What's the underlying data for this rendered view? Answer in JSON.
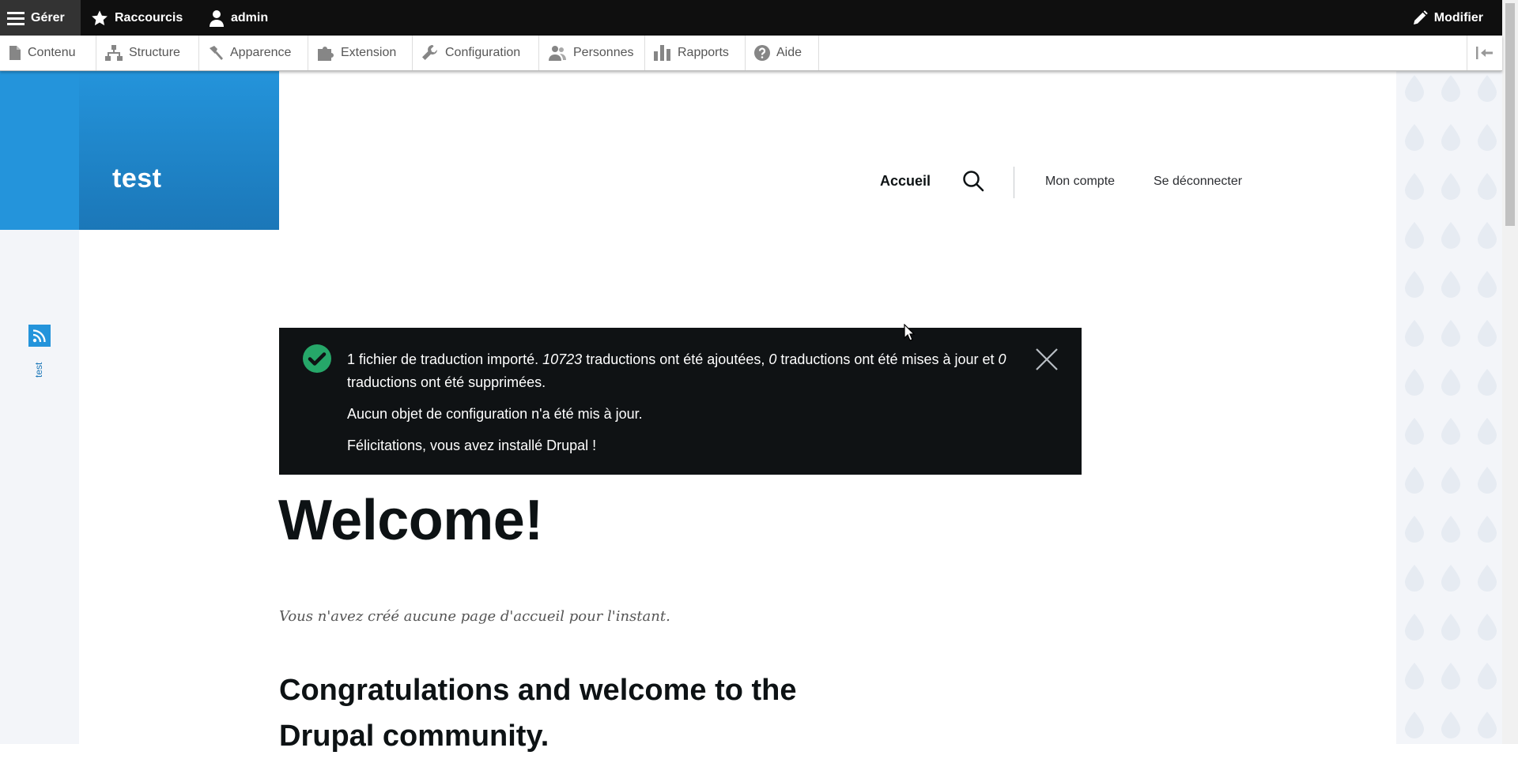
{
  "toolbar": {
    "manage": "Gérer",
    "shortcuts": "Raccourcis",
    "user": "admin",
    "edit": "Modifier"
  },
  "tray": {
    "items": [
      {
        "label": "Contenu",
        "icon": "file-icon"
      },
      {
        "label": "Structure",
        "icon": "sitemap-icon"
      },
      {
        "label": "Apparence",
        "icon": "paintbrush-icon"
      },
      {
        "label": "Extension",
        "icon": "puzzle-icon"
      },
      {
        "label": "Configuration",
        "icon": "wrench-icon"
      },
      {
        "label": "Personnes",
        "icon": "people-icon"
      },
      {
        "label": "Rapports",
        "icon": "bar-chart-icon"
      },
      {
        "label": "Aide",
        "icon": "help-icon"
      }
    ]
  },
  "header": {
    "site_name": "test",
    "nav_home": "Accueil",
    "account": "Mon compte",
    "logout": "Se déconnecter"
  },
  "social": {
    "label": "test"
  },
  "messages": {
    "line1_a": "1 fichier de traduction importé. ",
    "line1_added": "10723",
    "line1_b": " traductions ont été ajoutées, ",
    "line1_updated": "0",
    "line1_c": " traductions ont été mises à jour et ",
    "line1_deleted": "0",
    "line1_d": " traductions ont été supprimées.",
    "line2": "Aucun objet de configuration n'a été mis à jour.",
    "line3": "Félicitations, vous avez installé Drupal !"
  },
  "main": {
    "title": "Welcome!",
    "no_front_page": "Vous n'avez créé aucune page d'accueil pour l'instant.",
    "congrats": "Congratulations and welcome to the Drupal community."
  },
  "colors": {
    "accent": "#2494db",
    "accent_dark": "#1b77b8",
    "toolbar_bg": "#0f0f0f",
    "message_bg": "#0f1214",
    "success": "#26a769"
  }
}
